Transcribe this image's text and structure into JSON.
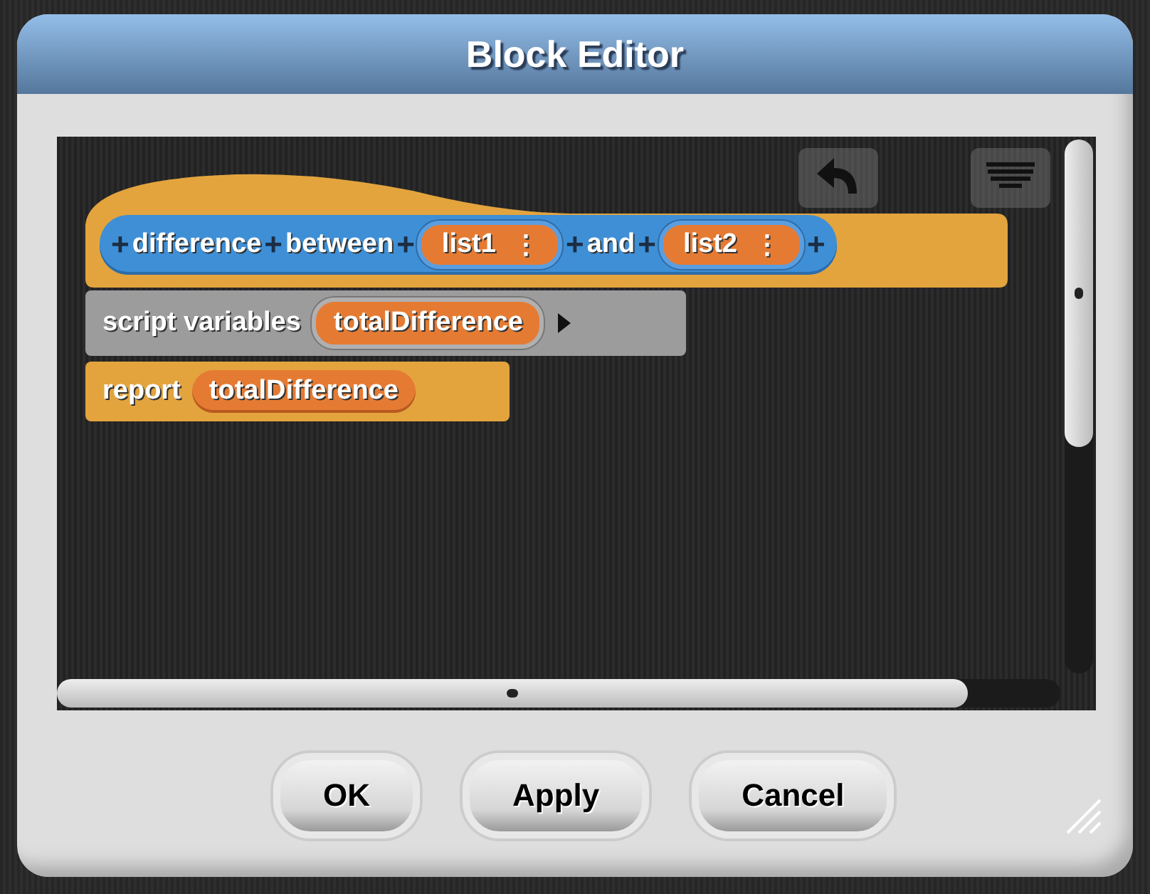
{
  "window": {
    "title": "Block Editor"
  },
  "prototype": {
    "parts": [
      {
        "kind": "plus",
        "text": "+"
      },
      {
        "kind": "label",
        "text": "difference"
      },
      {
        "kind": "plus",
        "text": "+"
      },
      {
        "kind": "label",
        "text": "between"
      },
      {
        "kind": "plus",
        "text": "+"
      },
      {
        "kind": "input",
        "text": "list1",
        "menu": "⋮"
      },
      {
        "kind": "plus",
        "text": "+"
      },
      {
        "kind": "label",
        "text": "and"
      },
      {
        "kind": "plus",
        "text": "+"
      },
      {
        "kind": "input",
        "text": "list2",
        "menu": "⋮"
      },
      {
        "kind": "plus",
        "text": "+"
      }
    ]
  },
  "script_variables": {
    "label": "script variables",
    "variables": [
      "totalDifference"
    ]
  },
  "report": {
    "label": "report",
    "value": "totalDifference"
  },
  "buttons": [
    "OK",
    "Apply",
    "Cancel"
  ]
}
